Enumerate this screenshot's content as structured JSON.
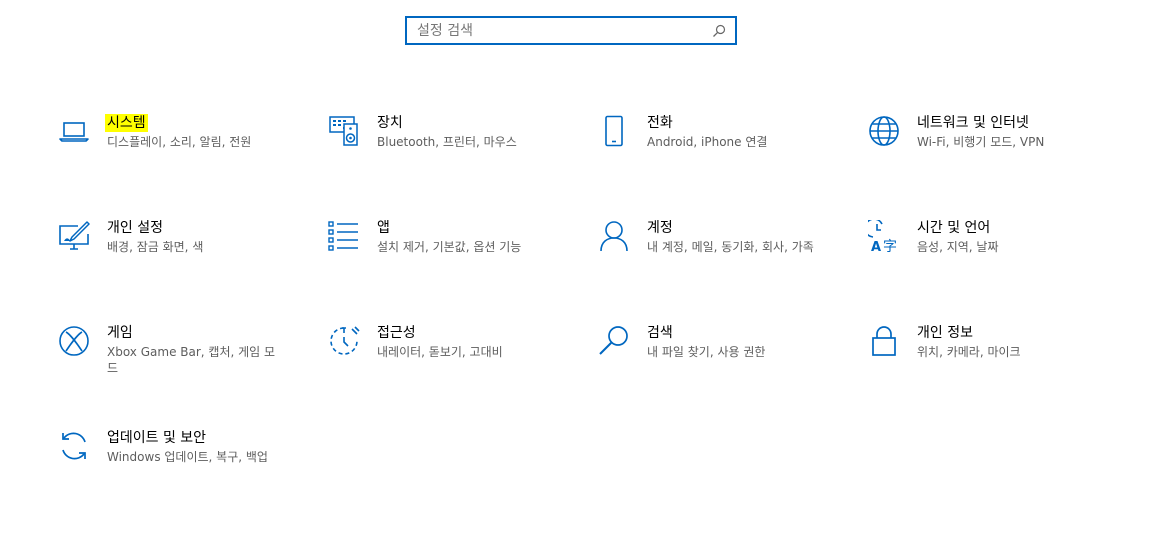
{
  "search": {
    "placeholder": "설정 검색"
  },
  "tiles": [
    {
      "title": "시스템",
      "desc": "디스플레이, 소리, 알림, 전원",
      "icon": "laptop-icon"
    },
    {
      "title": "장치",
      "desc": "Bluetooth, 프린터, 마우스",
      "icon": "devices-icon"
    },
    {
      "title": "전화",
      "desc": "Android, iPhone 연결",
      "icon": "phone-icon"
    },
    {
      "title": "네트워크 및 인터넷",
      "desc": "Wi-Fi, 비행기 모드, VPN",
      "icon": "globe-icon"
    },
    {
      "title": "개인 설정",
      "desc": "배경, 잠금 화면, 색",
      "icon": "personalization-icon"
    },
    {
      "title": "앱",
      "desc": "설치 제거, 기본값, 옵션 기능",
      "icon": "apps-list-icon"
    },
    {
      "title": "계정",
      "desc": "내 계정, 메일, 동기화, 회사, 가족",
      "icon": "person-icon"
    },
    {
      "title": "시간 및 언어",
      "desc": "음성, 지역, 날짜",
      "icon": "time-language-icon"
    },
    {
      "title": "게임",
      "desc": "Xbox Game Bar, 캡처, 게임 모드",
      "icon": "xbox-icon"
    },
    {
      "title": "접근성",
      "desc": "내레이터, 돋보기, 고대비",
      "icon": "accessibility-icon"
    },
    {
      "title": "검색",
      "desc": "내 파일 찾기, 사용 권한",
      "icon": "search-icon"
    },
    {
      "title": "개인 정보",
      "desc": "위치, 카메라, 마이크",
      "icon": "lock-icon"
    },
    {
      "title": "업데이트 및 보안",
      "desc": "Windows 업데이트, 복구, 백업",
      "icon": "sync-icon"
    }
  ],
  "colors": {
    "accent": "#0067c0",
    "highlight": "#ffff00"
  }
}
